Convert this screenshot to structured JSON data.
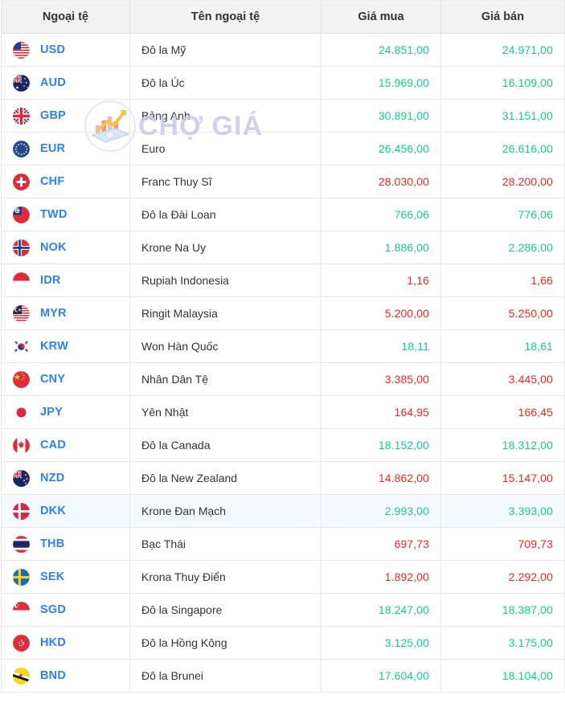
{
  "watermark": {
    "text": "CHỢ GIÁ",
    "logo_icon": "chart-money-logo-icon",
    "color": "#c8cbe8"
  },
  "colors": {
    "up": "#15cf86",
    "down": "#ff2323",
    "code": "#2f80f5",
    "header_bg": "#f2f2f2",
    "highlight_row_bg": "#f4f9fe",
    "border": "#e8e8e8"
  },
  "table": {
    "headers": [
      "Ngoại tệ",
      "Tên ngoại tệ",
      "Giá mua",
      "Giá bán"
    ],
    "rows": [
      {
        "code": "USD",
        "flag": "flag-us-icon",
        "name": "Đô la Mỹ",
        "buy": "24.851,00",
        "sell": "24.971,00",
        "buy_dir": "up",
        "sell_dir": "up",
        "highlight": false
      },
      {
        "code": "AUD",
        "flag": "flag-au-icon",
        "name": "Đô la Úc",
        "buy": "15.969,00",
        "sell": "16.109,00",
        "buy_dir": "up",
        "sell_dir": "up",
        "highlight": false
      },
      {
        "code": "GBP",
        "flag": "flag-gb-icon",
        "name": "Bảng Anh",
        "buy": "30.891,00",
        "sell": "31.151,00",
        "buy_dir": "up",
        "sell_dir": "up",
        "highlight": false
      },
      {
        "code": "EUR",
        "flag": "flag-eu-icon",
        "name": "Euro",
        "buy": "26.456,00",
        "sell": "26.616,00",
        "buy_dir": "up",
        "sell_dir": "up",
        "highlight": false
      },
      {
        "code": "CHF",
        "flag": "flag-ch-icon",
        "name": "Franc Thuy Sĩ",
        "buy": "28.030,00",
        "sell": "28.200,00",
        "buy_dir": "down",
        "sell_dir": "down",
        "highlight": false
      },
      {
        "code": "TWD",
        "flag": "flag-tw-icon",
        "name": "Đô la Đài Loan",
        "buy": "766,06",
        "sell": "776,06",
        "buy_dir": "up",
        "sell_dir": "up",
        "highlight": false
      },
      {
        "code": "NOK",
        "flag": "flag-no-icon",
        "name": "Krone Na Uy",
        "buy": "1.886,00",
        "sell": "2.286,00",
        "buy_dir": "up",
        "sell_dir": "up",
        "highlight": false
      },
      {
        "code": "IDR",
        "flag": "flag-id-icon",
        "name": "Rupiah Indonesia",
        "buy": "1,16",
        "sell": "1,66",
        "buy_dir": "down",
        "sell_dir": "down",
        "highlight": false
      },
      {
        "code": "MYR",
        "flag": "flag-my-icon",
        "name": "Ringit Malaysia",
        "buy": "5.200,00",
        "sell": "5.250,00",
        "buy_dir": "down",
        "sell_dir": "down",
        "highlight": false
      },
      {
        "code": "KRW",
        "flag": "flag-kr-icon",
        "name": "Won Hàn Quốc",
        "buy": "18,11",
        "sell": "18,61",
        "buy_dir": "up",
        "sell_dir": "up",
        "highlight": false
      },
      {
        "code": "CNY",
        "flag": "flag-cn-icon",
        "name": "Nhân Dân Tệ",
        "buy": "3.385,00",
        "sell": "3.445,00",
        "buy_dir": "down",
        "sell_dir": "down",
        "highlight": false
      },
      {
        "code": "JPY",
        "flag": "flag-jp-icon",
        "name": "Yên Nhật",
        "buy": "164,95",
        "sell": "166,45",
        "buy_dir": "down",
        "sell_dir": "down",
        "highlight": false
      },
      {
        "code": "CAD",
        "flag": "flag-ca-icon",
        "name": "Đô la Canada",
        "buy": "18.152,00",
        "sell": "18.312,00",
        "buy_dir": "up",
        "sell_dir": "up",
        "highlight": false
      },
      {
        "code": "NZD",
        "flag": "flag-nz-icon",
        "name": "Đô la New Zealand",
        "buy": "14.862,00",
        "sell": "15.147,00",
        "buy_dir": "down",
        "sell_dir": "down",
        "highlight": false
      },
      {
        "code": "DKK",
        "flag": "flag-dk-icon",
        "name": "Krone Đan Mạch",
        "buy": "2.993,00",
        "sell": "3.393,00",
        "buy_dir": "up",
        "sell_dir": "up",
        "highlight": true
      },
      {
        "code": "THB",
        "flag": "flag-th-icon",
        "name": "Bạc Thái",
        "buy": "697,73",
        "sell": "709,73",
        "buy_dir": "down",
        "sell_dir": "down",
        "highlight": false
      },
      {
        "code": "SEK",
        "flag": "flag-se-icon",
        "name": "Krona Thuy Điển",
        "buy": "1.892,00",
        "sell": "2.292,00",
        "buy_dir": "down",
        "sell_dir": "down",
        "highlight": false
      },
      {
        "code": "SGD",
        "flag": "flag-sg-icon",
        "name": "Đô la Singapore",
        "buy": "18.247,00",
        "sell": "18.387,00",
        "buy_dir": "up",
        "sell_dir": "up",
        "highlight": false
      },
      {
        "code": "HKD",
        "flag": "flag-hk-icon",
        "name": "Đô la Hồng Kông",
        "buy": "3.125,00",
        "sell": "3.175,00",
        "buy_dir": "up",
        "sell_dir": "up",
        "highlight": false
      },
      {
        "code": "BND",
        "flag": "flag-bn-icon",
        "name": "Đô la Brunei",
        "buy": "17.604,00",
        "sell": "18.104,00",
        "buy_dir": "up",
        "sell_dir": "up",
        "highlight": false
      }
    ]
  }
}
